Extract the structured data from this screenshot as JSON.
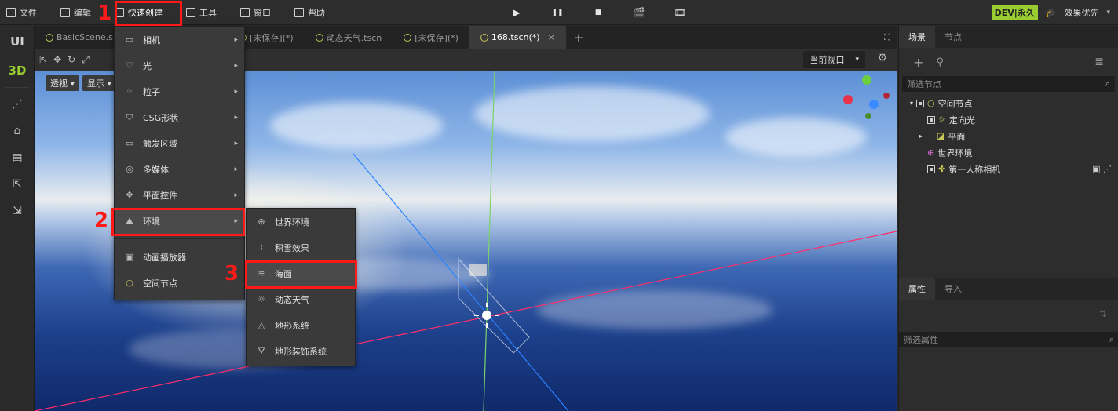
{
  "menubar": {
    "items": [
      {
        "label": "文件",
        "icon": "folder-icon"
      },
      {
        "label": "编辑",
        "icon": "crop-icon"
      },
      {
        "label": "快速创建",
        "icon": "edit-icon"
      },
      {
        "label": "工具",
        "icon": "window-icon"
      },
      {
        "label": "窗口",
        "icon": "frame-icon"
      },
      {
        "label": "帮助",
        "icon": "help-icon"
      }
    ],
    "controls": [
      "▶",
      "❚❚",
      "■",
      "🎬",
      "🎞"
    ],
    "dev_badge": "DEV|永久",
    "quality": "效果优先"
  },
  "left_bar": {
    "ui_label": "UI",
    "three_d_label": "3D"
  },
  "tabs": {
    "items": [
      "BasicScene.s",
      "[未保存](*)",
      "动态天气.tscn",
      "[未保存](*)",
      "168.tscn(*)"
    ],
    "close": "×",
    "add": "+"
  },
  "viewport": {
    "view_select": "当前视口",
    "perspective": "透视 ▾",
    "display": "显示 ▾"
  },
  "quick_create_menu": {
    "items": [
      {
        "label": "相机",
        "icon": "▭",
        "arrow": "▸"
      },
      {
        "label": "光",
        "icon": "♡",
        "arrow": "▸"
      },
      {
        "label": "粒子",
        "icon": "⁘",
        "arrow": "▸"
      },
      {
        "label": "CSG形状",
        "icon": "⛉",
        "arrow": "▸"
      },
      {
        "label": "触发区域",
        "icon": "▭",
        "arrow": "▸"
      },
      {
        "label": "多媒体",
        "icon": "◎",
        "arrow": "▸"
      },
      {
        "label": "平面控件",
        "icon": "✥",
        "arrow": "▸"
      },
      {
        "label": "环境",
        "icon": "⛰",
        "arrow": "▸"
      },
      {
        "label": "动画播放器",
        "icon": "▣",
        "arrow": ""
      },
      {
        "label": "空间节点",
        "icon": "○",
        "arrow": ""
      }
    ]
  },
  "env_submenu": {
    "items": [
      {
        "label": "世界环境",
        "icon": "⊕"
      },
      {
        "label": "积雪效果",
        "icon": "⁞"
      },
      {
        "label": "海面",
        "icon": "≋"
      },
      {
        "label": "动态天气",
        "icon": "☼"
      },
      {
        "label": "地形系统",
        "icon": "△"
      },
      {
        "label": "地形装饰系统",
        "icon": "⛛"
      }
    ]
  },
  "annotations": {
    "n1": "1",
    "n2": "2",
    "n3": "3"
  },
  "right_panel": {
    "tabs": [
      "场景",
      "节点"
    ],
    "filter_placeholder": "筛选节点",
    "tree": [
      "空间节点",
      "定向光",
      "平面",
      "世界环境",
      "第一人称相机"
    ],
    "prop_tabs": [
      "属性",
      "导入"
    ],
    "prop_filter": "筛选属性"
  }
}
